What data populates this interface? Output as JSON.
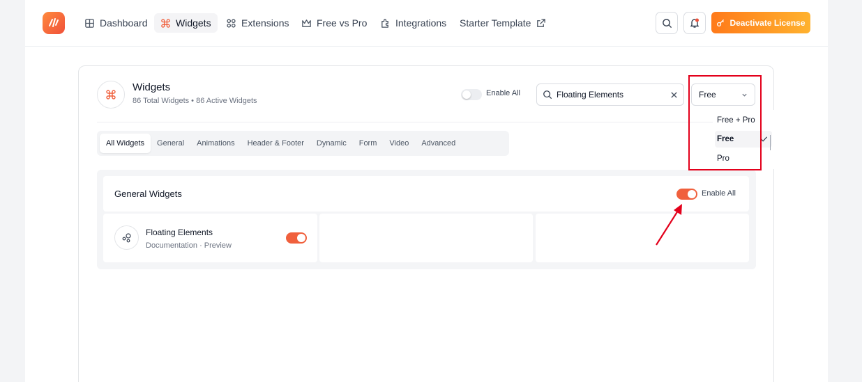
{
  "nav": {
    "items": [
      {
        "label": "Dashboard",
        "icon": "grid-icon"
      },
      {
        "label": "Widgets",
        "icon": "command-icon",
        "active": true
      },
      {
        "label": "Extensions",
        "icon": "extensions-icon"
      },
      {
        "label": "Free vs Pro",
        "icon": "crown-icon"
      },
      {
        "label": "Integrations",
        "icon": "puzzle-icon"
      },
      {
        "label": "Starter Template",
        "icon": "external-link-icon"
      }
    ],
    "deactivate_label": "Deactivate License"
  },
  "widgets": {
    "title": "Widgets",
    "subtitle": "86 Total Widgets • 86 Active Widgets",
    "enable_all_label": "Enable All",
    "enable_all_on": false,
    "search_value": "Floating Elements",
    "filter_selected": "Free",
    "filter_options": [
      "Free + Pro",
      "Free",
      "Pro"
    ]
  },
  "tabs": [
    "All Widgets",
    "General",
    "Animations",
    "Header & Footer",
    "Dynamic",
    "Form",
    "Video",
    "Advanced"
  ],
  "section": {
    "title": "General Widgets",
    "enable_all_label": "Enable All",
    "enable_all_on": true
  },
  "widget_card": {
    "name": "Floating Elements",
    "doc_link": "Documentation",
    "separator": "·",
    "preview_link": "Preview",
    "enabled": true
  },
  "colors": {
    "accent": "#f0603d",
    "highlight": "#e3001b"
  }
}
